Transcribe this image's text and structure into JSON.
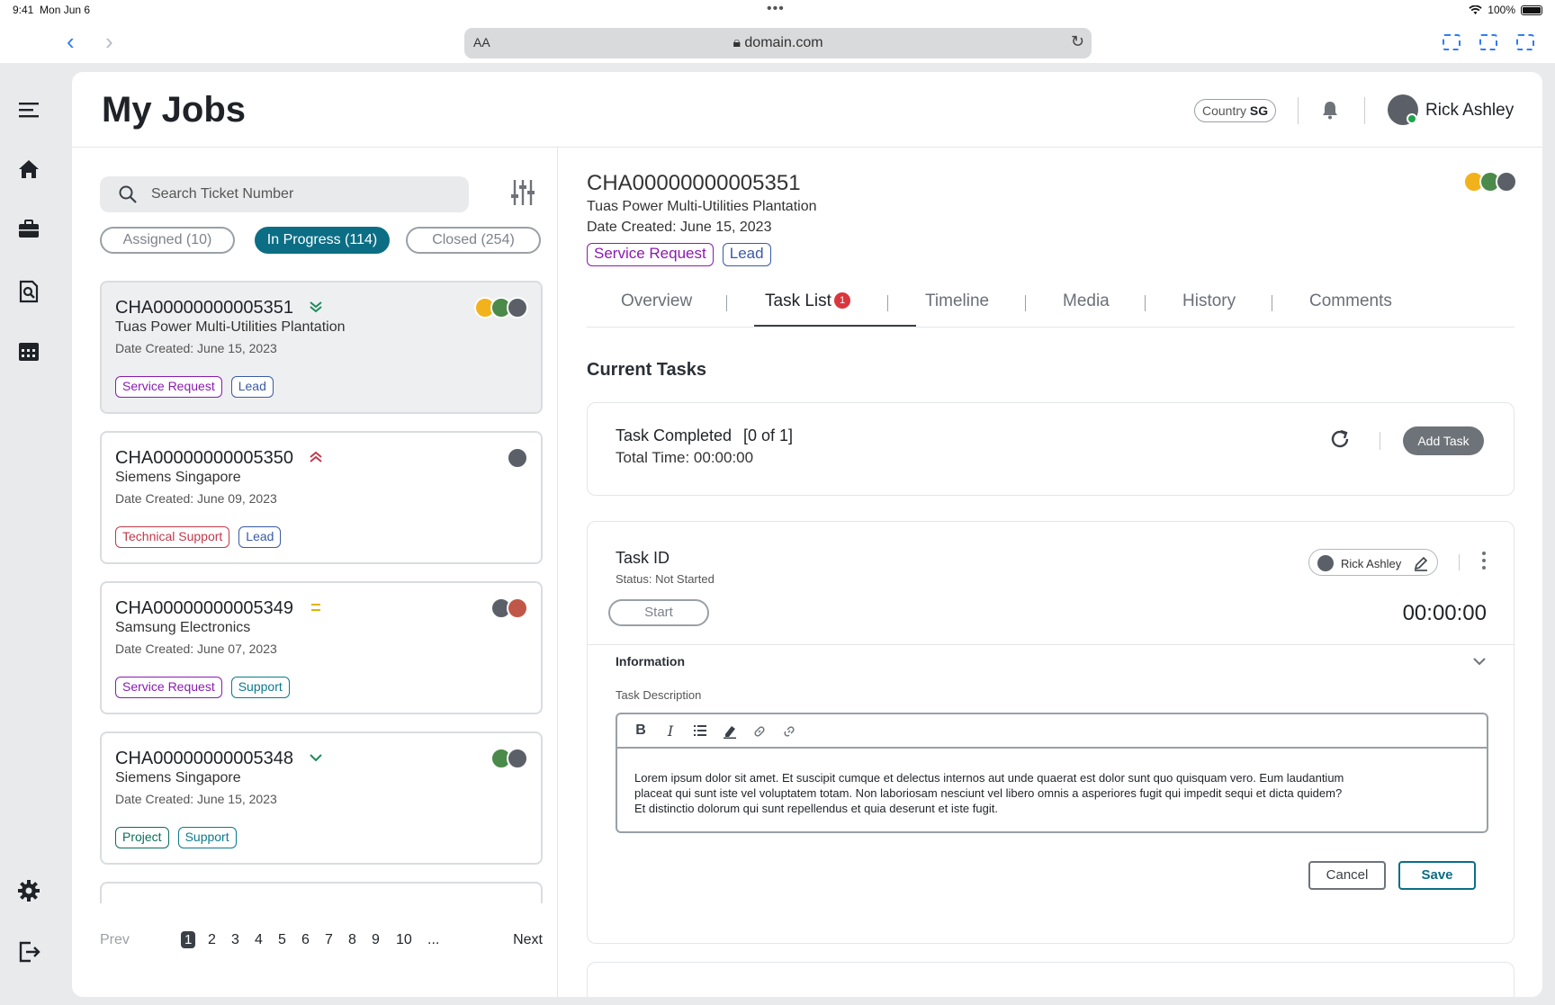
{
  "status_bar": {
    "time": "9:41",
    "date": "Mon Jun 6",
    "battery": "100%"
  },
  "browser": {
    "text_size_label": "AA",
    "url": "domain.com"
  },
  "header": {
    "title": "My Jobs",
    "country_label": "Country",
    "country_value": "SG",
    "user_name": "Rick Ashley"
  },
  "search": {
    "placeholder": "Search Ticket Number"
  },
  "filters": [
    {
      "label": "Assigned (10)",
      "active": false
    },
    {
      "label": "In Progress (114)",
      "active": true
    },
    {
      "label": "Closed (254)",
      "active": false
    }
  ],
  "jobs": [
    {
      "id": "CHA00000000005351",
      "company": "Tuas Power Multi-Utilities Plantation",
      "date": "Date Created: June 15, 2023",
      "priority": "lowest",
      "tags": [
        "Service Request",
        "Lead"
      ]
    },
    {
      "id": "CHA00000000005350",
      "company": "Siemens Singapore",
      "date": "Date Created: June 09, 2023",
      "priority": "highest",
      "tags": [
        "Technical Support",
        "Lead"
      ]
    },
    {
      "id": "CHA00000000005349",
      "company": "Samsung Electronics",
      "date": "Date Created: June 07, 2023",
      "priority": "medium",
      "tags": [
        "Service Request",
        "Support"
      ]
    },
    {
      "id": "CHA00000000005348",
      "company": "Siemens Singapore",
      "date": "Date Created: June 15, 2023",
      "priority": "low",
      "tags": [
        "Project",
        "Support"
      ]
    }
  ],
  "pagination": {
    "prev": "Prev",
    "next": "Next",
    "current": "1",
    "pages": [
      "2",
      "3",
      "4",
      "5",
      "6",
      "7",
      "8",
      "9",
      "10",
      "..."
    ]
  },
  "detail": {
    "id": "CHA00000000005351",
    "company": "Tuas Power Multi-Utilities Plantation",
    "date": "Date Created: June 15, 2023",
    "tags": [
      "Service Request",
      "Lead"
    ],
    "tabs": [
      "Overview",
      "Task List",
      "Timeline",
      "Media",
      "History",
      "Comments"
    ],
    "active_tab": "Task List",
    "task_list_badge": "1",
    "section_title": "Current Tasks",
    "summary": {
      "title": "Task Completed",
      "count": "[0 of 1]",
      "total_time": "Total Time: 00:00:00",
      "add_task": "Add Task"
    },
    "task": {
      "title": "Task ID",
      "status": "Status: Not Started",
      "assignee": "Rick Ashley",
      "start_label": "Start",
      "timer": "00:00:00",
      "info_label": "Information",
      "desc_label": "Task Description",
      "description": "Lorem ipsum dolor sit amet. Et suscipit cumque et delectus internos aut unde quaerat est dolor sunt quo quisquam vero. Eum laudantium placeat qui sunt iste vel voluptatem totam. Non laboriosam nesciunt vel libero omnis a asperiores fugit qui impedit sequi et dicta quidem? Et distinctio dolorum qui sunt repellendus et quia deserunt et iste fugit.",
      "cancel": "Cancel",
      "save": "Save"
    }
  },
  "colors": {
    "accent": "#0b6e85",
    "service_request": "#8a1bb0",
    "lead": "#3a5aa6",
    "technical_support": "#c0394a",
    "support": "#0b7a8c",
    "badge": "#d9363e"
  },
  "icons": {
    "sidebar": [
      "menu-icon",
      "home-icon",
      "briefcase-icon",
      "document-search-icon",
      "calendar-icon",
      "settings-icon",
      "logout-icon"
    ],
    "toolbar": [
      "bold-icon",
      "italic-icon",
      "list-icon",
      "highlight-icon",
      "link-icon",
      "unlink-icon"
    ]
  }
}
